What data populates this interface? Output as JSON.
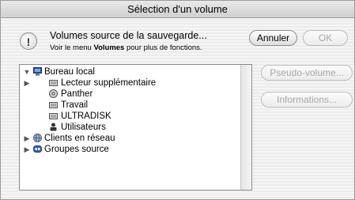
{
  "window": {
    "title": "Sélection d'un volume"
  },
  "header": {
    "title": "Volumes source de la sauvegarde...",
    "subtitle_prefix": "Voir le menu ",
    "subtitle_bold": "Volumes",
    "subtitle_suffix": " pour plus de fonctions."
  },
  "buttons": {
    "cancel": "Annuler",
    "ok": "OK",
    "pseudo_volume": "Pseudo-volume...",
    "informations": "Informations..."
  },
  "tree": [
    {
      "label": "Bureau local",
      "icon": "computer-icon",
      "expanded": true,
      "level": 0
    },
    {
      "label": "Lecteur supplémentaire",
      "icon": "drive-icon",
      "expandable": true,
      "level": 1
    },
    {
      "label": "Panther",
      "icon": "disk-icon",
      "level": 1
    },
    {
      "label": "Travail",
      "icon": "drive-icon",
      "level": 1
    },
    {
      "label": "ULTRADISK",
      "icon": "drive-icon",
      "level": 1
    },
    {
      "label": "Utilisateurs",
      "icon": "users-icon",
      "level": 1
    },
    {
      "label": "Clients en réseau",
      "icon": "globe-icon",
      "expandable": true,
      "level": 0
    },
    {
      "label": "Groupes source",
      "icon": "group-icon",
      "expandable": true,
      "level": 0
    }
  ]
}
